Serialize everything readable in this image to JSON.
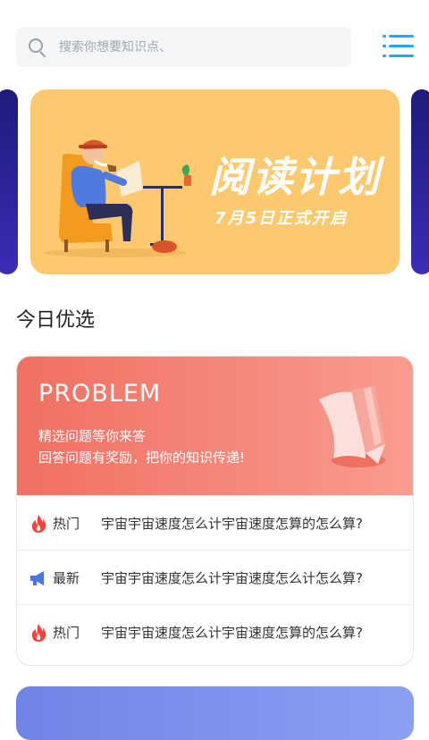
{
  "search": {
    "placeholder": "搜索你想要知识点、"
  },
  "banner": {
    "title": "阅读计划",
    "subtitle": "7月5日正式开启"
  },
  "section": {
    "title": "今日优选"
  },
  "problem": {
    "title": "PROBLEM",
    "line1": "精选问题等你来答",
    "line2": "回答问题有奖励，把你的知识传递!"
  },
  "rows": [
    {
      "tag": "热门",
      "icon": "fire-icon",
      "text": "宇宙宇宙速度怎么计宇宙速度怎算的怎么算?"
    },
    {
      "tag": "最新",
      "icon": "megaphone-icon",
      "text": "宇宙宇宙速度怎么计宇宙速度怎么计怎么算?"
    },
    {
      "tag": "热门",
      "icon": "fire-icon",
      "text": "宇宙宇宙速度怎么计宇宙速度怎算的怎么算?"
    }
  ],
  "colors": {
    "accent": "#2aa6f0",
    "banner_bg": "#fcc96f",
    "problem_gradient_start": "#f07062",
    "problem_gradient_end": "#f99c8f",
    "fire": "#f0443a",
    "megaphone": "#4a73e8"
  }
}
